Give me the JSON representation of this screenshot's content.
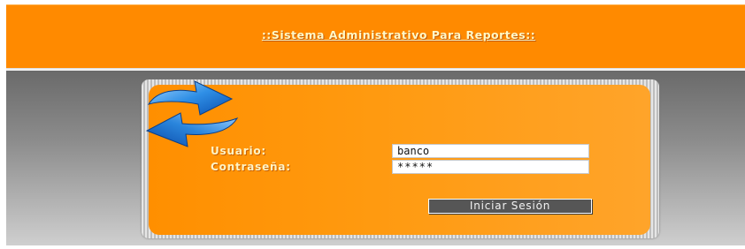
{
  "header": {
    "title": "::Sistema Administrativo Para Reportes::"
  },
  "login": {
    "logo_icon": "refresh-arrows-icon",
    "user_label": "Usuario:",
    "user_value": "banco",
    "password_label": "Contraseña:",
    "password_value": "*****",
    "submit_label": "Iniciar Sesión"
  },
  "colors": {
    "header_bg": "#ff8a00",
    "panel_bg": "#ff9a10",
    "button_bg": "#565656",
    "label_text": "#fff4c6"
  }
}
